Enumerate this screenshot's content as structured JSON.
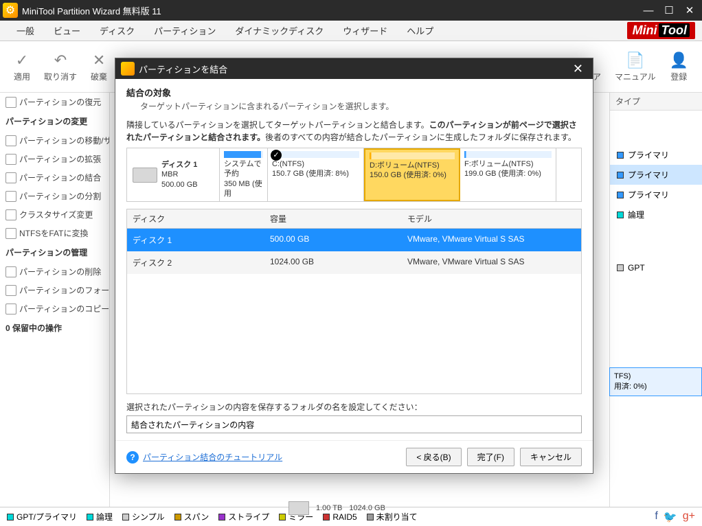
{
  "window": {
    "title": "MiniTool Partition Wizard 無料版 11"
  },
  "menu": {
    "items": [
      "一般",
      "ビュー",
      "ディスク",
      "パーティション",
      "ダイナミックディスク",
      "ウィザード",
      "ヘルプ"
    ],
    "logo1": "Mini",
    "logo2": "Tool"
  },
  "toolbar": {
    "apply": "適用",
    "undo": "取り消す",
    "discard": "破棄",
    "media_frag": "ィア",
    "manual": "マニュアル",
    "register": "登録"
  },
  "sidebar": {
    "restore": "パーティションの復元",
    "sec_change": "パーティションの変更",
    "items_change": [
      "パーティションの移動/サ",
      "パーティションの拡張",
      "パーティションの結合",
      "パーティションの分割",
      "クラスタサイズ変更",
      "NTFSをFATに変換"
    ],
    "sec_manage": "パーティションの管理",
    "items_manage": [
      "パーティションの削除",
      "パーティションのフォーマ",
      "パーティションのコピー"
    ],
    "pending": "0 保留中の操作"
  },
  "right": {
    "header": "タイプ",
    "rows": [
      "プライマリ",
      "プライマリ",
      "プライマリ",
      "論理"
    ],
    "gpt": "GPT"
  },
  "bg": {
    "disk2_size": "1.00 TB",
    "disk2_cap": "1024.0 GB",
    "frag1": "TFS)",
    "frag2": "用済: 0%)"
  },
  "legend": [
    "GPT/プライマリ",
    "論理",
    "シンプル",
    "スパン",
    "ストライプ",
    "ミラー",
    "RAID5",
    "未割り当て"
  ],
  "dialog": {
    "title": "パーティションを結合",
    "heading": "結合の対象",
    "sub": "ターゲットパーティションに含まれるパーティションを選択します。",
    "instr_a": "隣接しているパーティションを選択してターゲットパーティションと結合します。",
    "instr_b": "このパーティションが前ページで選択されたパーティションと結合されます。",
    "instr_c": "後者のすべての内容が結合したパーティションに生成したフォルダに保存されます。",
    "disk": {
      "name": "ディスク 1",
      "type": "MBR",
      "size": "500.00 GB"
    },
    "parts": {
      "sys": {
        "name": "システムで予約",
        "info": "350 MB (使用"
      },
      "c": {
        "name": "C:(NTFS)",
        "info": "150.7 GB (使用済: 8%)"
      },
      "d": {
        "name": "D:ボリューム(NTFS)",
        "info": "150.0 GB (使用済: 0%)"
      },
      "f": {
        "name": "F:ボリューム(NTFS)",
        "info": "199.0 GB (使用済: 0%)"
      }
    },
    "table": {
      "h1": "ディスク",
      "h2": "容量",
      "h3": "モデル",
      "rows": [
        {
          "disk": "ディスク 1",
          "cap": "500.00 GB",
          "model": "VMware, VMware Virtual S SAS"
        },
        {
          "disk": "ディスク 2",
          "cap": "1024.00 GB",
          "model": "VMware, VMware Virtual S SAS"
        }
      ]
    },
    "folder_label": "選択されたパーティションの内容を保存するフォルダの名を設定してください：",
    "folder_value": "結合されたパーティションの内容",
    "help_link": "パーティション結合のチュートリアル",
    "btn_back": "< 戻る(B)",
    "btn_finish": "完了(F)",
    "btn_cancel": "キャンセル"
  }
}
